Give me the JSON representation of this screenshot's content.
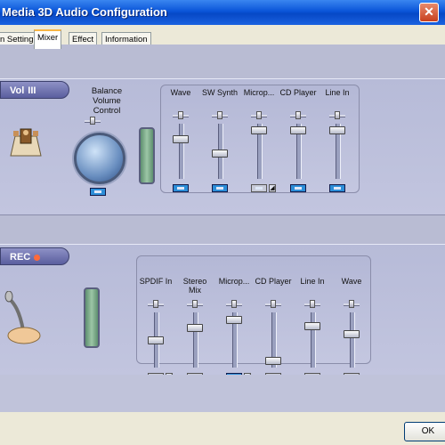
{
  "window": {
    "title": "Media 3D Audio Configuration",
    "close_glyph": "✕"
  },
  "tabs": [
    {
      "label": "n Setting"
    },
    {
      "label": "Mixer"
    },
    {
      "label": "Effect"
    },
    {
      "label": "Information"
    }
  ],
  "active_tab": "Mixer",
  "playback": {
    "section_label": "Vol",
    "balance_title_line1": "Balance",
    "balance_title_line2": "Volume Control",
    "channels": [
      {
        "name": "Wave",
        "level": 0.75,
        "mute": "on"
      },
      {
        "name": "SW Synth",
        "level": 0.45,
        "mute": "on"
      },
      {
        "name": "Microp...",
        "level": 0.95,
        "mute": "off"
      },
      {
        "name": "CD Player",
        "level": 0.95,
        "mute": "on"
      },
      {
        "name": "Line In",
        "level": 0.95,
        "mute": "on"
      }
    ]
  },
  "recording": {
    "section_label": "REC",
    "channels": [
      {
        "name": "SPDIF In",
        "level": 0.5,
        "mute": "off"
      },
      {
        "name": "Stereo Mix",
        "level": 0.75,
        "mute": "off"
      },
      {
        "name": "Microp...",
        "level": 0.92,
        "mute": "on"
      },
      {
        "name": "CD Player",
        "level": 0.05,
        "mute": "off"
      },
      {
        "name": "Line In",
        "level": 0.8,
        "mute": "off"
      },
      {
        "name": "Wave",
        "level": 0.62,
        "mute": "off"
      }
    ]
  },
  "buttons": {
    "ok": "OK"
  },
  "colors": {
    "title_bar": "#0a55d8",
    "panel": "#b9bcd3",
    "active_mute": "#2d8ed8"
  }
}
